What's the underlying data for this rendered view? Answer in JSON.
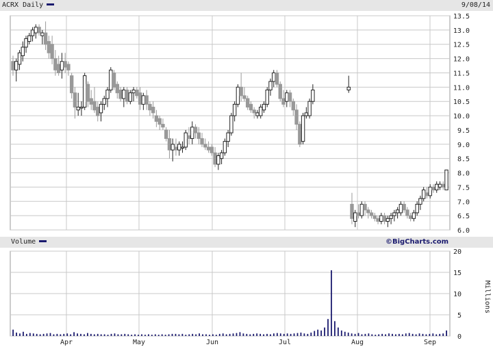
{
  "header": {
    "symbol_label": "ACRX Daily",
    "date": "9/08/14"
  },
  "volume_header": {
    "label": "Volume",
    "brand": "©BigCharts.com"
  },
  "colors": {
    "up": "#222222",
    "down": "#999999",
    "volume": "#1a1a6e",
    "grid": "#c8c8c8",
    "legend_key": "#1a1a6e"
  },
  "chart_data": [
    {
      "type": "candlestick",
      "title": "ACRX Daily",
      "ylim": [
        6.0,
        13.5
      ],
      "yticks": [
        "13.5",
        "13.0",
        "12.5",
        "12.0",
        "11.5",
        "11.0",
        "10.5",
        "10.0",
        "9.5",
        "9.0",
        "8.5",
        "8.0",
        "7.5",
        "7.0",
        "6.5",
        "6.0"
      ],
      "xticks": [
        "Apr",
        "May",
        "Jun",
        "Jul",
        "Aug",
        "Sep"
      ],
      "grid": true,
      "series": [
        {
          "o": 11.9,
          "h": 12.1,
          "l": 11.4,
          "c": 11.6
        },
        {
          "o": 11.6,
          "h": 12.0,
          "l": 11.2,
          "c": 11.9
        },
        {
          "o": 11.8,
          "h": 12.3,
          "l": 11.6,
          "c": 12.2
        },
        {
          "o": 12.1,
          "h": 12.6,
          "l": 11.9,
          "c": 12.4
        },
        {
          "o": 12.4,
          "h": 12.8,
          "l": 12.2,
          "c": 12.7
        },
        {
          "o": 12.6,
          "h": 12.9,
          "l": 12.5,
          "c": 12.8
        },
        {
          "o": 12.8,
          "h": 13.1,
          "l": 12.6,
          "c": 13.0
        },
        {
          "o": 12.9,
          "h": 13.2,
          "l": 12.7,
          "c": 13.1
        },
        {
          "o": 13.1,
          "h": 13.2,
          "l": 12.8,
          "c": 12.9
        },
        {
          "o": 12.8,
          "h": 13.0,
          "l": 12.5,
          "c": 12.9
        },
        {
          "o": 12.9,
          "h": 13.3,
          "l": 12.3,
          "c": 12.5
        },
        {
          "o": 12.6,
          "h": 12.8,
          "l": 12.0,
          "c": 12.2
        },
        {
          "o": 12.5,
          "h": 12.8,
          "l": 11.8,
          "c": 12.0
        },
        {
          "o": 12.0,
          "h": 12.3,
          "l": 11.4,
          "c": 11.6
        },
        {
          "o": 11.8,
          "h": 12.1,
          "l": 11.4,
          "c": 11.5
        },
        {
          "o": 11.6,
          "h": 12.2,
          "l": 11.3,
          "c": 11.9
        },
        {
          "o": 11.9,
          "h": 12.2,
          "l": 11.5,
          "c": 11.7
        },
        {
          "o": 11.8,
          "h": 11.9,
          "l": 11.4,
          "c": 11.6
        },
        {
          "o": 11.4,
          "h": 11.5,
          "l": 10.6,
          "c": 10.8
        },
        {
          "o": 10.8,
          "h": 11.0,
          "l": 9.9,
          "c": 10.3
        },
        {
          "o": 10.2,
          "h": 10.8,
          "l": 10.0,
          "c": 10.3
        },
        {
          "o": 10.3,
          "h": 10.5,
          "l": 10.0,
          "c": 10.3
        },
        {
          "o": 10.3,
          "h": 11.5,
          "l": 10.2,
          "c": 11.4
        },
        {
          "o": 11.1,
          "h": 11.2,
          "l": 10.3,
          "c": 10.5
        },
        {
          "o": 10.6,
          "h": 10.9,
          "l": 10.2,
          "c": 10.4
        },
        {
          "o": 10.5,
          "h": 11.0,
          "l": 10.1,
          "c": 10.2
        },
        {
          "o": 10.3,
          "h": 10.5,
          "l": 9.8,
          "c": 10.0
        },
        {
          "o": 10.1,
          "h": 10.5,
          "l": 9.8,
          "c": 10.4
        },
        {
          "o": 10.4,
          "h": 10.7,
          "l": 10.2,
          "c": 10.6
        },
        {
          "o": 10.6,
          "h": 11.0,
          "l": 10.3,
          "c": 10.9
        },
        {
          "o": 10.9,
          "h": 11.7,
          "l": 10.8,
          "c": 11.6
        },
        {
          "o": 11.5,
          "h": 11.6,
          "l": 10.9,
          "c": 11.0
        },
        {
          "o": 11.1,
          "h": 11.2,
          "l": 10.6,
          "c": 10.8
        },
        {
          "o": 10.9,
          "h": 11.0,
          "l": 10.5,
          "c": 10.6
        },
        {
          "o": 10.6,
          "h": 11.0,
          "l": 10.3,
          "c": 10.9
        },
        {
          "o": 10.9,
          "h": 11.0,
          "l": 10.4,
          "c": 10.5
        },
        {
          "o": 10.5,
          "h": 10.9,
          "l": 10.4,
          "c": 10.8
        },
        {
          "o": 10.8,
          "h": 11.0,
          "l": 10.5,
          "c": 10.9
        },
        {
          "o": 10.9,
          "h": 11.0,
          "l": 10.6,
          "c": 10.7
        },
        {
          "o": 10.8,
          "h": 11.0,
          "l": 10.2,
          "c": 10.4
        },
        {
          "o": 10.4,
          "h": 10.8,
          "l": 10.2,
          "c": 10.7
        },
        {
          "o": 10.7,
          "h": 10.9,
          "l": 10.2,
          "c": 10.4
        },
        {
          "o": 10.4,
          "h": 10.5,
          "l": 10.0,
          "c": 10.2
        },
        {
          "o": 10.3,
          "h": 10.5,
          "l": 9.9,
          "c": 10.1
        },
        {
          "o": 10.0,
          "h": 10.2,
          "l": 9.6,
          "c": 9.8
        },
        {
          "o": 9.9,
          "h": 10.0,
          "l": 9.5,
          "c": 9.7
        },
        {
          "o": 9.7,
          "h": 9.9,
          "l": 9.5,
          "c": 9.6
        },
        {
          "o": 9.5,
          "h": 9.6,
          "l": 9.1,
          "c": 9.2
        },
        {
          "o": 9.2,
          "h": 9.5,
          "l": 8.5,
          "c": 8.8
        },
        {
          "o": 8.8,
          "h": 9.2,
          "l": 8.4,
          "c": 9.0
        },
        {
          "o": 8.9,
          "h": 9.2,
          "l": 8.6,
          "c": 8.8
        },
        {
          "o": 8.8,
          "h": 9.1,
          "l": 8.6,
          "c": 9.0
        },
        {
          "o": 8.9,
          "h": 9.1,
          "l": 8.7,
          "c": 8.9
        },
        {
          "o": 8.9,
          "h": 9.5,
          "l": 8.8,
          "c": 9.4
        },
        {
          "o": 9.3,
          "h": 9.6,
          "l": 9.0,
          "c": 9.2
        },
        {
          "o": 9.2,
          "h": 9.8,
          "l": 9.0,
          "c": 9.6
        },
        {
          "o": 9.6,
          "h": 9.7,
          "l": 9.2,
          "c": 9.4
        },
        {
          "o": 9.4,
          "h": 9.6,
          "l": 9.0,
          "c": 9.2
        },
        {
          "o": 9.2,
          "h": 9.4,
          "l": 8.9,
          "c": 9.0
        },
        {
          "o": 9.0,
          "h": 9.2,
          "l": 8.8,
          "c": 8.9
        },
        {
          "o": 8.9,
          "h": 9.1,
          "l": 8.7,
          "c": 8.8
        },
        {
          "o": 8.9,
          "h": 9.0,
          "l": 8.6,
          "c": 8.7
        },
        {
          "o": 8.7,
          "h": 8.9,
          "l": 8.2,
          "c": 8.3
        },
        {
          "o": 8.3,
          "h": 8.7,
          "l": 8.1,
          "c": 8.6
        },
        {
          "o": 8.5,
          "h": 8.8,
          "l": 8.3,
          "c": 8.7
        },
        {
          "o": 8.7,
          "h": 9.2,
          "l": 8.6,
          "c": 9.1
        },
        {
          "o": 9.1,
          "h": 9.5,
          "l": 8.9,
          "c": 9.4
        },
        {
          "o": 9.4,
          "h": 10.1,
          "l": 9.3,
          "c": 10.0
        },
        {
          "o": 10.0,
          "h": 10.5,
          "l": 9.8,
          "c": 10.4
        },
        {
          "o": 10.4,
          "h": 11.1,
          "l": 10.3,
          "c": 11.0
        },
        {
          "o": 11.0,
          "h": 11.5,
          "l": 10.5,
          "c": 10.7
        },
        {
          "o": 10.7,
          "h": 11.0,
          "l": 10.5,
          "c": 10.6
        },
        {
          "o": 10.6,
          "h": 10.7,
          "l": 10.2,
          "c": 10.3
        },
        {
          "o": 10.4,
          "h": 10.5,
          "l": 10.1,
          "c": 10.2
        },
        {
          "o": 10.2,
          "h": 10.3,
          "l": 9.9,
          "c": 10.1
        },
        {
          "o": 10.0,
          "h": 10.2,
          "l": 9.9,
          "c": 10.1
        },
        {
          "o": 10.0,
          "h": 10.4,
          "l": 9.9,
          "c": 10.3
        },
        {
          "o": 10.2,
          "h": 10.5,
          "l": 10.1,
          "c": 10.4
        },
        {
          "o": 10.4,
          "h": 11.0,
          "l": 10.3,
          "c": 10.9
        },
        {
          "o": 10.9,
          "h": 11.3,
          "l": 10.7,
          "c": 11.2
        },
        {
          "o": 11.2,
          "h": 11.6,
          "l": 11.0,
          "c": 11.5
        },
        {
          "o": 11.5,
          "h": 11.6,
          "l": 11.0,
          "c": 11.1
        },
        {
          "o": 11.1,
          "h": 11.2,
          "l": 10.5,
          "c": 10.6
        },
        {
          "o": 10.6,
          "h": 10.9,
          "l": 10.3,
          "c": 10.4
        },
        {
          "o": 10.5,
          "h": 10.9,
          "l": 10.3,
          "c": 10.8
        },
        {
          "o": 10.8,
          "h": 10.9,
          "l": 10.3,
          "c": 10.5
        },
        {
          "o": 10.5,
          "h": 10.6,
          "l": 10.0,
          "c": 10.2
        },
        {
          "o": 10.2,
          "h": 10.4,
          "l": 9.5,
          "c": 9.7
        },
        {
          "o": 9.7,
          "h": 9.8,
          "l": 8.9,
          "c": 9.0
        },
        {
          "o": 9.1,
          "h": 10.1,
          "l": 9.0,
          "c": 10.0
        },
        {
          "o": 10.0,
          "h": 10.3,
          "l": 9.9,
          "c": 10.1
        },
        {
          "o": 10.0,
          "h": 10.6,
          "l": 9.9,
          "c": 10.5
        },
        {
          "o": 10.5,
          "h": 11.1,
          "l": 10.4,
          "c": 10.9
        },
        {
          "o": 10.9,
          "h": 11.4,
          "l": 10.8,
          "c": 11.0
        },
        {
          "o": 6.9,
          "h": 7.3,
          "l": 6.2,
          "c": 6.4
        },
        {
          "o": 6.3,
          "h": 6.7,
          "l": 6.1,
          "c": 6.6
        },
        {
          "o": 6.6,
          "h": 6.9,
          "l": 6.4,
          "c": 6.5
        },
        {
          "o": 6.5,
          "h": 7.0,
          "l": 6.4,
          "c": 6.9
        },
        {
          "o": 6.9,
          "h": 7.0,
          "l": 6.5,
          "c": 6.7
        },
        {
          "o": 6.7,
          "h": 6.8,
          "l": 6.4,
          "c": 6.6
        },
        {
          "o": 6.6,
          "h": 6.7,
          "l": 6.4,
          "c": 6.5
        },
        {
          "o": 6.5,
          "h": 6.6,
          "l": 6.3,
          "c": 6.4
        },
        {
          "o": 6.4,
          "h": 6.5,
          "l": 6.2,
          "c": 6.3
        },
        {
          "o": 6.3,
          "h": 6.6,
          "l": 6.2,
          "c": 6.5
        },
        {
          "o": 6.5,
          "h": 6.6,
          "l": 6.2,
          "c": 6.3
        },
        {
          "o": 6.3,
          "h": 6.5,
          "l": 6.1,
          "c": 6.4
        },
        {
          "o": 6.4,
          "h": 6.6,
          "l": 6.2,
          "c": 6.5
        },
        {
          "o": 6.5,
          "h": 6.7,
          "l": 6.3,
          "c": 6.6
        },
        {
          "o": 6.6,
          "h": 6.8,
          "l": 6.4,
          "c": 6.7
        },
        {
          "o": 6.6,
          "h": 7.0,
          "l": 6.5,
          "c": 6.9
        },
        {
          "o": 6.9,
          "h": 7.0,
          "l": 6.6,
          "c": 6.7
        },
        {
          "o": 6.7,
          "h": 6.8,
          "l": 6.4,
          "c": 6.5
        },
        {
          "o": 6.5,
          "h": 6.6,
          "l": 6.3,
          "c": 6.4
        },
        {
          "o": 6.4,
          "h": 6.7,
          "l": 6.3,
          "c": 6.6
        },
        {
          "o": 6.6,
          "h": 7.0,
          "l": 6.5,
          "c": 6.9
        },
        {
          "o": 6.9,
          "h": 7.2,
          "l": 6.7,
          "c": 7.1
        },
        {
          "o": 7.1,
          "h": 7.5,
          "l": 7.0,
          "c": 7.4
        },
        {
          "o": 7.3,
          "h": 7.5,
          "l": 7.1,
          "c": 7.2
        },
        {
          "o": 7.2,
          "h": 7.6,
          "l": 7.1,
          "c": 7.5
        },
        {
          "o": 7.5,
          "h": 7.6,
          "l": 7.3,
          "c": 7.4
        },
        {
          "o": 7.4,
          "h": 7.7,
          "l": 7.3,
          "c": 7.6
        },
        {
          "o": 7.5,
          "h": 7.7,
          "l": 7.4,
          "c": 7.6
        },
        {
          "o": 7.6,
          "h": 7.7,
          "l": 7.4,
          "c": 7.5
        },
        {
          "o": 7.4,
          "h": 8.1,
          "l": 7.4,
          "c": 8.1
        }
      ]
    },
    {
      "type": "bar",
      "title": "Volume",
      "ylabel": "Millions",
      "ylim": [
        0,
        20
      ],
      "yticks": [
        "20",
        "15",
        "10",
        "5",
        "0"
      ],
      "xticks": [
        "Apr",
        "May",
        "Jun",
        "Jul",
        "Aug",
        "Sep"
      ],
      "grid": true,
      "values": [
        1.5,
        0.8,
        0.6,
        1.0,
        0.5,
        0.7,
        0.6,
        0.5,
        0.4,
        0.5,
        0.6,
        0.7,
        0.4,
        0.5,
        0.4,
        0.5,
        0.6,
        0.4,
        0.9,
        0.6,
        0.5,
        0.4,
        0.7,
        0.5,
        0.4,
        0.5,
        0.4,
        0.4,
        0.3,
        0.5,
        0.6,
        0.4,
        0.4,
        0.5,
        0.4,
        0.3,
        0.4,
        0.3,
        0.4,
        0.3,
        0.4,
        0.3,
        0.4,
        0.3,
        0.4,
        0.3,
        0.4,
        0.5,
        0.5,
        0.4,
        0.5,
        0.3,
        0.4,
        0.5,
        0.4,
        0.6,
        0.4,
        0.4,
        0.3,
        0.4,
        0.3,
        0.5,
        0.6,
        0.4,
        0.5,
        0.6,
        0.7,
        0.9,
        0.6,
        0.5,
        0.4,
        0.5,
        0.6,
        0.5,
        0.4,
        0.5,
        0.4,
        0.6,
        0.7,
        0.6,
        0.5,
        0.6,
        0.5,
        0.6,
        0.7,
        0.8,
        0.6,
        0.5,
        0.8,
        1.2,
        1.5,
        1.3,
        2.0,
        4.0,
        15.5,
        3.5,
        2.0,
        1.3,
        1.0,
        0.8,
        0.6,
        0.5,
        0.7,
        0.4,
        0.5,
        0.6,
        0.4,
        0.3,
        0.4,
        0.5,
        0.4,
        0.6,
        0.5,
        0.4,
        0.5,
        0.4,
        0.6,
        0.7,
        0.5,
        0.4,
        0.6,
        0.5,
        0.4,
        0.5,
        0.6,
        0.4,
        0.5,
        0.6,
        1.3
      ]
    }
  ]
}
